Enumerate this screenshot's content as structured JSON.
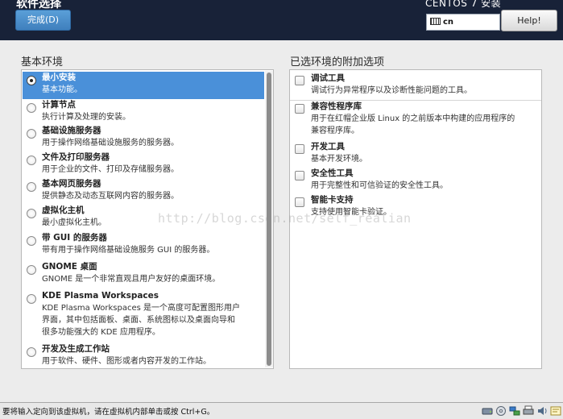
{
  "header": {
    "page_title": "软件选择",
    "done_label": "完成(D)",
    "product_title": "CENTOS 7 安装",
    "keyboard_layout": "cn",
    "help_label": "Help!"
  },
  "left": {
    "label": "基本环境",
    "items": [
      {
        "name": "最小安装",
        "desc": [
          "基本功能。"
        ],
        "selected": true
      },
      {
        "name": "计算节点",
        "desc": [
          "执行计算及处理的安装。"
        ]
      },
      {
        "name": "基础设施服务器",
        "desc": [
          "用于操作网络基础设施服务的服务器。"
        ]
      },
      {
        "name": "文件及打印服务器",
        "desc": [
          "用于企业的文件、打印及存储服务器。"
        ]
      },
      {
        "name": "基本网页服务器",
        "desc": [
          "提供静态及动态互联网内容的服务器。"
        ]
      },
      {
        "name": "虚拟化主机",
        "desc": [
          "最小虚拟化主机。"
        ]
      },
      {
        "name": "带 GUI 的服务器",
        "desc": [
          "带有用于操作网络基础设施服务 GUI 的服务器。"
        ]
      },
      {
        "name": "GNOME 桌面",
        "desc": [
          "GNOME 是一个非常直观且用户友好的桌面环境。"
        ]
      },
      {
        "name": "KDE Plasma Workspaces",
        "desc": [
          "KDE Plasma Workspaces 是一个高度可配置图形用户",
          "界面，其中包括面板、桌面、系统图标以及桌面向导和",
          "很多功能强大的 KDE 应用程序。"
        ]
      },
      {
        "name": "开发及生成工作站",
        "desc": [
          "用于软件、硬件、图形或者内容开发的工作站。"
        ]
      }
    ]
  },
  "right": {
    "label": "已选环境的附加选项",
    "items": [
      {
        "name": "调试工具",
        "desc": [
          "调试行为异常程序以及诊断性能问题的工具。"
        ]
      },
      {
        "name": "兼容性程序库",
        "desc": [
          "用于在红帽企业版 Linux 的之前版本中构建的应用程序的",
          "兼容程序库。"
        ]
      },
      {
        "name": "开发工具",
        "desc": [
          "基本开发环境。"
        ]
      },
      {
        "name": "安全性工具",
        "desc": [
          "用于完整性和可信验证的安全性工具。"
        ]
      },
      {
        "name": "智能卡支持",
        "desc": [
          "支持使用智能卡验证。"
        ]
      }
    ]
  },
  "watermark": "http://blog.csdn.net/self_realian",
  "statusbar": {
    "text": "要将输入定向到该虚拟机，请在虚拟机内部单击或按 Ctrl+G。"
  }
}
